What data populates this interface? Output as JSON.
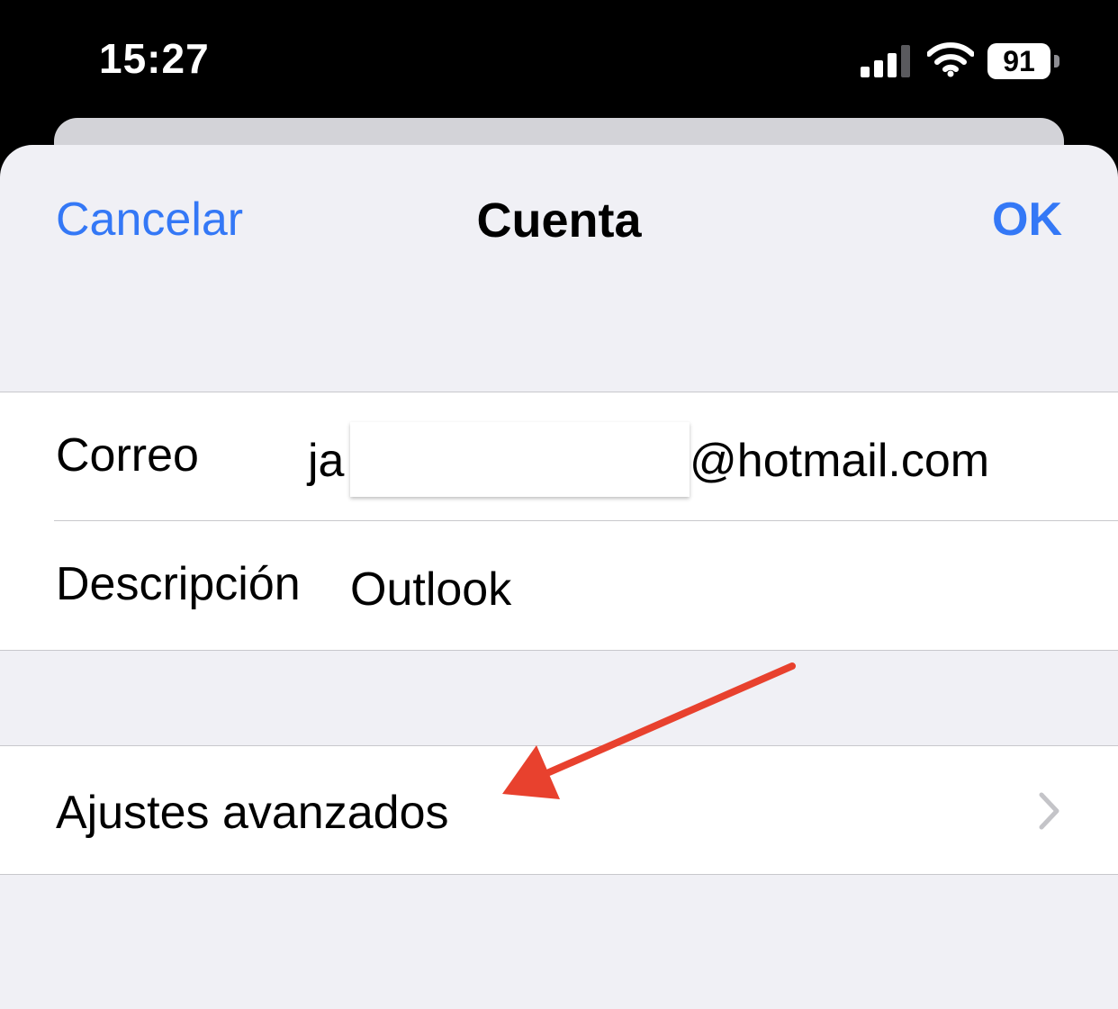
{
  "status_bar": {
    "time": "15:27",
    "battery_level": "91",
    "signal_bars": 3,
    "signal_bars_total": 4,
    "icons": [
      "cellular-signal-icon",
      "wifi-icon",
      "battery-icon"
    ]
  },
  "nav": {
    "cancel_label": "Cancelar",
    "title": "Cuenta",
    "ok_label": "OK"
  },
  "account_fields": [
    {
      "label": "Correo",
      "value_prefix": "ja",
      "value_suffix": "@hotmail.com"
    },
    {
      "label": "Descripción",
      "value": "Outlook"
    }
  ],
  "advanced": {
    "label": "Ajustes avanzados",
    "icon": "chevron-right-icon"
  },
  "colors": {
    "accent": "#3478f6",
    "sheet_background": "#f0f0f5",
    "annotation_arrow": "#e8412e"
  }
}
